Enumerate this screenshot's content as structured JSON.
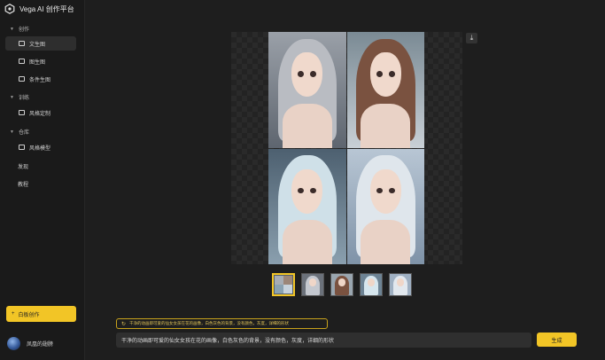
{
  "app": {
    "title": "Vega AI 创作平台",
    "accent": "#f2c526"
  },
  "sidebar": {
    "sections": [
      {
        "label": "创作",
        "items": [
          {
            "label": "文生图",
            "icon": "image-icon",
            "active": true
          },
          {
            "label": "图生图",
            "icon": "image-icon",
            "active": false
          },
          {
            "label": "条件生图",
            "icon": "image-icon",
            "active": false
          }
        ]
      },
      {
        "label": "训练",
        "items": [
          {
            "label": "风格定制",
            "icon": "image-icon",
            "active": false
          }
        ]
      },
      {
        "label": "仓库",
        "items": [
          {
            "label": "风格模型",
            "icon": "layers-icon",
            "active": false
          }
        ]
      }
    ],
    "links": [
      "发现",
      "教程"
    ],
    "new_button": "白板创作",
    "user_name": "凤凰的翅膀"
  },
  "result": {
    "image_count": 4,
    "thumbnail_count": 5,
    "selected_thumbnail": 1
  },
  "prompt": {
    "history_text": "干净的动画即可爱的仙女女孩在花的画像，白色灰色的背景，没有颜色，灰度，详细的形状",
    "input_text": "干净的动画即可爱的仙女女孩在花的画像，白色灰色的背景，没有颜色，灰度，详细的形状",
    "generate_label": "生成"
  }
}
